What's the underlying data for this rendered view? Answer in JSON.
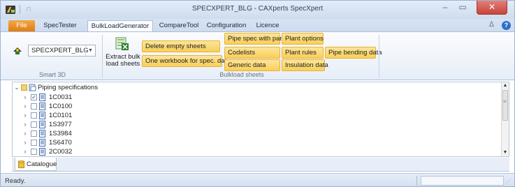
{
  "window": {
    "title": "SPECXPERT_BLG - CAXperts SpecXpert",
    "minimize_glyph": "–",
    "maximize_glyph": "▭",
    "close_glyph": "✕",
    "icons": [
      "app-icon",
      "quick-access-icon"
    ]
  },
  "tabs": [
    {
      "label": "File",
      "active": false,
      "color": "#E88A1A"
    },
    {
      "label": "SpecTester",
      "active": false
    },
    {
      "label": "BulkLoadGenerator",
      "active": true
    },
    {
      "label": "CompareTool",
      "active": false
    },
    {
      "label": "Configuration",
      "active": false
    },
    {
      "label": "Licence",
      "active": false
    }
  ],
  "tabbar_right": {
    "collapse_glyph": "ᐃ",
    "help_glyph": "?"
  },
  "ribbon": {
    "smart3d": {
      "group_label": "Smart 3D",
      "combo_value": "SPECXPERT_BLG",
      "combo_arrow": "▼",
      "icon": "plant-icon"
    },
    "bulkload": {
      "group_label": "Bulkload sheets",
      "extract_label_line1": "Extract bulk",
      "extract_label_line2": "load sheets",
      "delete_empty": "Delete empty sheets",
      "one_workbook": "One workbook for spec. data",
      "pipe_spec_parts": "Pipe spec with parts",
      "codelists": "Codelists",
      "generic_data": "Generic data",
      "plant_options": "Plant options",
      "plant_rules": "Plant rules",
      "insulation_data": "Insulation data",
      "pipe_bending": "Pipe bending data",
      "button_color": "#F9D46A"
    }
  },
  "tree": {
    "root": {
      "label": "Piping specifications",
      "expander": "⌄",
      "checked": false
    },
    "items": [
      {
        "label": "1C0031",
        "checked": true,
        "expander": "›"
      },
      {
        "label": "1C0100",
        "checked": false,
        "expander": "›"
      },
      {
        "label": "1C0101",
        "checked": false,
        "expander": "›"
      },
      {
        "label": "1S3977",
        "checked": false,
        "expander": "›"
      },
      {
        "label": "1S3984",
        "checked": false,
        "expander": "›"
      },
      {
        "label": "1S6470",
        "checked": false,
        "expander": "›"
      },
      {
        "label": "2C0032",
        "checked": false,
        "expander": "›"
      }
    ],
    "check_glyph": "✓",
    "scroll_up": "▲",
    "scroll_down": "▼",
    "scroll_grip": "≡"
  },
  "bottom_tab": {
    "label": "Catalogue",
    "icon": "catalogue-icon"
  },
  "status": {
    "text": "Ready.",
    "grip_glyph": "⋰"
  }
}
